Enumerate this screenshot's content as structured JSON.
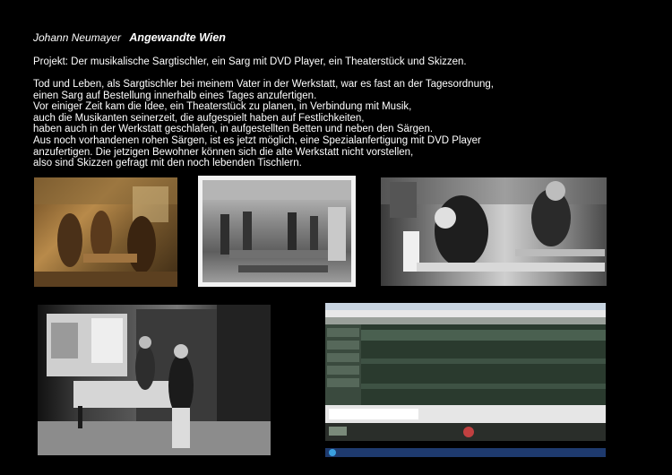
{
  "header": {
    "author": "Johann Neumayer",
    "institution": "Angewandte Wien"
  },
  "project_line": "Projekt: Der musikalische Sargtischler, ein Sarg mit DVD Player, ein Theaterstück und Skizzen.",
  "paragraph": [
    "Tod und Leben, als Sargtischler bei meinem Vater in der Werkstatt, war es fast an der Tagesordnung,",
    "einen Sarg auf Bestellung innerhalb eines Tages anzufertigen.",
    "Vor einiger Zeit kam die Idee, ein Theaterstück zu planen, in Verbindung mit Musik,",
    "auch die Musikanten  seinerzeit, die aufgespielt haben auf Festlichkeiten,",
    "haben auch in der Werkstatt geschlafen, in aufgestellten Betten und neben den Särgen.",
    "Aus noch vorhandenen rohen Särgen, ist es jetzt möglich, eine Spezialanfertigung mit DVD Player",
    "anzufertigen. Die jetzigen Bewohner können sich die alte Werkstatt nicht vorstellen,",
    "also  sind Skizzen gefragt mit den noch lebenden Tischlern."
  ]
}
